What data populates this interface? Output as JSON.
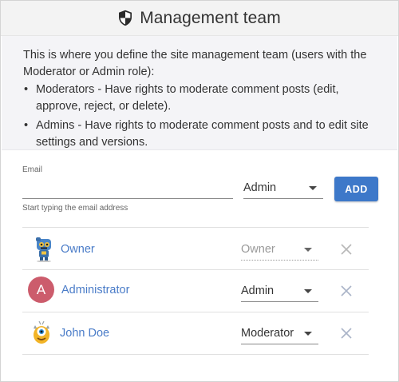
{
  "header": {
    "title": "Management team",
    "icon": "shield-icon"
  },
  "info": {
    "intro": "This is where you define the site management team (users with the Moderator or Admin role):",
    "bullets": [
      "Moderators - Have rights to moderate comment posts (edit, approve, reject, or delete).",
      "Admins - Have rights to moderate comment posts and to edit site settings and versions."
    ]
  },
  "add_form": {
    "email_label": "Email",
    "email_value": "",
    "email_hint": "Start typing the email address",
    "role_value": "Admin",
    "add_label": "ADD"
  },
  "members": [
    {
      "name": "Owner",
      "role": "Owner",
      "avatar": "robot-avatar",
      "role_editable": false
    },
    {
      "name": "Administrator",
      "role": "Admin",
      "avatar_letter": "A",
      "avatar_color": "#cc5c6c",
      "role_editable": true
    },
    {
      "name": "John Doe",
      "role": "Moderator",
      "avatar": "monster-avatar",
      "role_editable": true
    }
  ],
  "colors": {
    "accent": "#3d78c9",
    "link": "#4a7cc8",
    "remove_icon": "#aab4c8"
  }
}
